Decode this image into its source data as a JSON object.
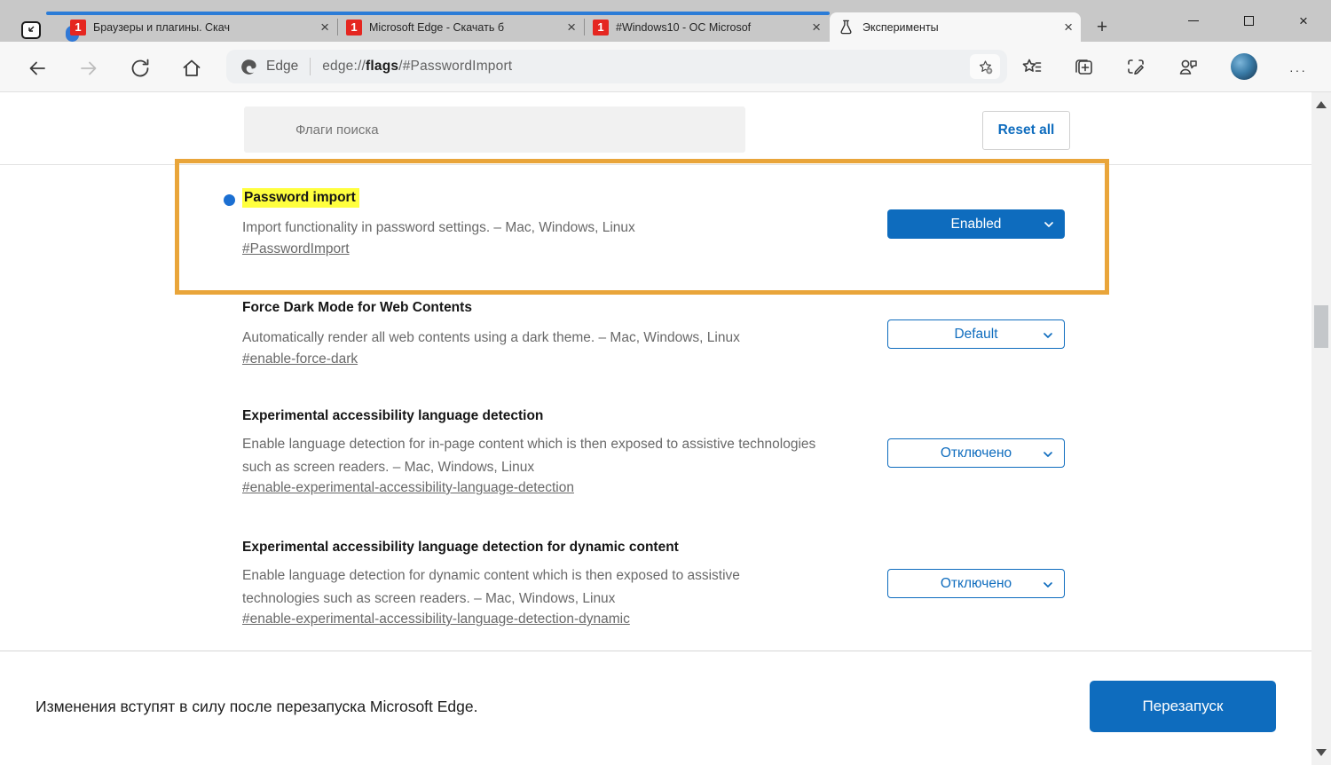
{
  "colors": {
    "accent_blue": "#0e6cbe",
    "highlight_yellow": "#ffff3e",
    "annotation_orange": "#e9a53a",
    "tab_group_blue": "#2b7cd7",
    "favicon_red": "#e52620"
  },
  "icons": {
    "close": "×",
    "new_tab": "+",
    "more": "···",
    "favicon_text": "1"
  },
  "tab_bar": {
    "tabs": [
      {
        "title": "Браузеры и плагины. Скач"
      },
      {
        "title": "Microsoft Edge - Скачать б"
      },
      {
        "title": "#Windows10 - ОС Microsof"
      },
      {
        "title": "Эксперименты"
      }
    ]
  },
  "toolbar": {
    "site_label": "Edge",
    "url": {
      "scheme": "edge://",
      "highlight": "flags",
      "rest": "/#PasswordImport"
    }
  },
  "page": {
    "search_placeholder": "Флаги поиска",
    "reset_all_label": "Reset all",
    "flags": [
      {
        "title": "Password import",
        "description": "Import functionality in password settings. – Mac, Windows, Linux",
        "permalink": "#PasswordImport",
        "value": "Enabled"
      },
      {
        "title": "Force Dark Mode for Web Contents",
        "description": "Automatically render all web contents using a dark theme. – Mac, Windows, Linux",
        "permalink": "#enable-force-dark",
        "value": "Default"
      },
      {
        "title": "Experimental accessibility language detection",
        "description": "Enable language detection for in-page content which is then exposed to assistive technologies such as screen readers. – Mac, Windows, Linux",
        "permalink": "#enable-experimental-accessibility-language-detection",
        "value": "Отключено"
      },
      {
        "title": "Experimental accessibility language detection for dynamic content",
        "description": "Enable language detection for dynamic content which is then exposed to assistive technologies such as screen readers. – Mac, Windows, Linux",
        "permalink": "#enable-experimental-accessibility-language-detection-dynamic",
        "value": "Отключено"
      }
    ],
    "footer": {
      "message": "Изменения вступят в силу после перезапуска Microsoft Edge.",
      "restart_label": "Перезапуск"
    }
  }
}
